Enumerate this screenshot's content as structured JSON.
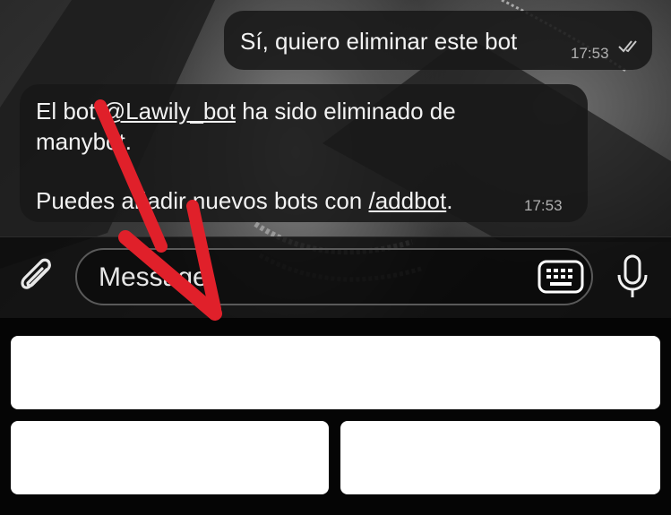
{
  "chat": {
    "outgoing": {
      "text": "Sí, quiero eliminar este bot",
      "time": "17:53"
    },
    "incoming": {
      "line1_prefix": "El bot ",
      "line1_link": "@Lawily_bot",
      "line1_suffix": " ha sido eliminado de",
      "line2": "manybot.",
      "line3_prefix": "Puedes añadir nuevos bots con ",
      "line3_link": "/addbot",
      "line3_suffix": ".",
      "time": "17:53"
    }
  },
  "input_bar": {
    "placeholder": "Message",
    "attach_icon": "paperclip-icon",
    "keyboard_icon": "keyboard-icon",
    "mic_icon": "microphone-icon"
  },
  "reply_keyboard": {
    "buttons": [
      "",
      "",
      ""
    ]
  },
  "annotation": {
    "arrow_color": "#e0202a"
  },
  "colors": {
    "bubble_bg": "#181818",
    "button_bg": "#ffffff"
  }
}
